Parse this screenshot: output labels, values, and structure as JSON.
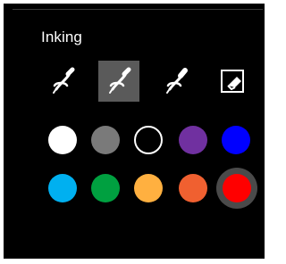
{
  "panel": {
    "title": "Inking"
  },
  "tools": [
    {
      "name": "pen-tool",
      "icon": "pen-icon",
      "selected": false
    },
    {
      "name": "pencil-tool",
      "icon": "pencil-icon",
      "selected": true
    },
    {
      "name": "highlighter-tool",
      "icon": "highlighter-icon",
      "selected": false
    },
    {
      "name": "eraser-tool",
      "icon": "eraser-icon",
      "selected": false
    }
  ],
  "colors": {
    "row1": [
      "#ffffff",
      "#7a7a7a",
      "transparent",
      "#7030a0",
      "#0000ff"
    ],
    "row2": [
      "#00b0f0",
      "#00a040",
      "#ffb040",
      "#f06030",
      "#ff0000"
    ],
    "selected": "#ff0000",
    "accent_background": "#000000",
    "selected_tool_background": "#5a5a5a"
  }
}
